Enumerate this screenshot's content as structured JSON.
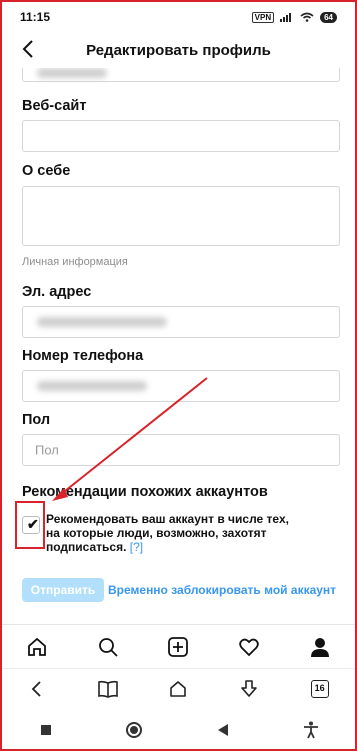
{
  "status_bar": {
    "time": "11:15",
    "vpn": "VPN",
    "battery": "64"
  },
  "header": {
    "title": "Редактировать профиль",
    "back_icon": "chevron-left-icon"
  },
  "form": {
    "website_label": "Веб-сайт",
    "bio_label": "О себе",
    "section_private": "Личная информация",
    "email_label": "Эл. адрес",
    "phone_label": "Номер телефона",
    "gender_label": "Пол",
    "gender_placeholder": "Пол",
    "recommend_title": "Рекомендации похожих аккаунтов",
    "recommend_text": "Рекомендовать ваш аккаунт в числе тех, на которые люди, возможно, захотят подписаться.",
    "recommend_help": "[?]",
    "recommend_checked": true,
    "submit_label": "Отправить",
    "block_label": "Временно заблокировать мой аккаунт"
  },
  "tabbar": [
    "home-icon",
    "search-icon",
    "new-post-icon",
    "heart-icon",
    "profile-icon"
  ],
  "browser_bar": {
    "tabs_count": "16"
  },
  "colors": {
    "accent": "#3897f0",
    "annotation": "#d9232b",
    "submit_disabled": "#b2dffc"
  }
}
